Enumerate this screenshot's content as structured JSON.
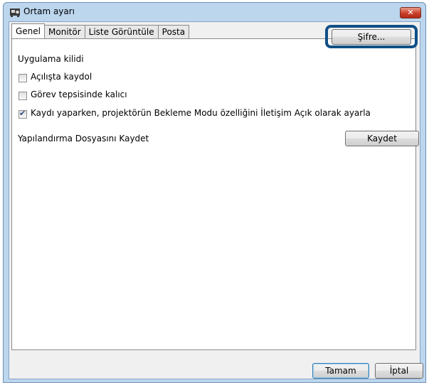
{
  "window": {
    "title": "Ortam ayarı"
  },
  "tabs": [
    "Genel",
    "Monitör",
    "Liste Görüntüle",
    "Posta"
  ],
  "settings": {
    "app_lock_label": "Uygulama kilidi",
    "password_button": "Şifre...",
    "startup_label": "Açılışta kaydol",
    "tray_label": "Görev tepsisinde kalıcı",
    "standby_label": "Kaydı yaparken, projektörün Bekleme Modu özelliğini İletişim Açık olarak ayarla",
    "save_config_label": "Yapılandırma Dosyasını Kaydet",
    "save_button": "Kaydet"
  },
  "checkboxes": {
    "startup": false,
    "tray": false,
    "standby": true
  },
  "footer": {
    "ok_button": "Tamam",
    "cancel_button": "İptal"
  },
  "icons": {
    "close": "close-icon",
    "app": "projector-icon"
  }
}
